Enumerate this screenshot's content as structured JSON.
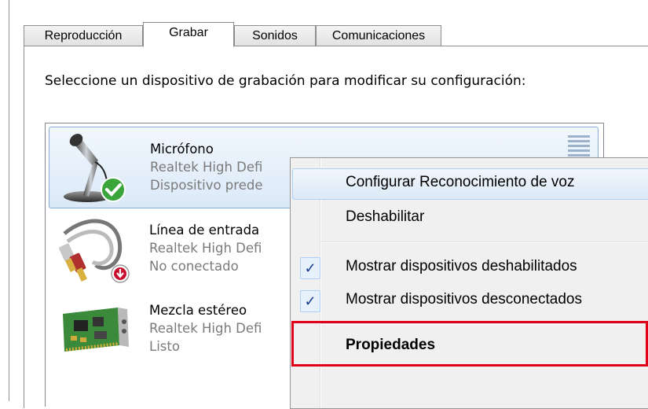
{
  "tabs": [
    {
      "label": "Reproducción"
    },
    {
      "label": "Grabar",
      "active": true
    },
    {
      "label": "Sonidos"
    },
    {
      "label": "Comunicaciones"
    }
  ],
  "instruction": "Seleccione un dispositivo de grabación para modificar su configuración:",
  "devices": [
    {
      "name": "Micrófono",
      "driver": "Realtek High Defi",
      "status": "Dispositivo prede",
      "icon": "microphone-icon",
      "badge": "default-check-icon",
      "selected": true
    },
    {
      "name": "Línea de entrada",
      "driver": "Realtek High Defi",
      "status": "No conectado",
      "icon": "line-in-cable-icon",
      "badge": "disconnected-arrow-icon"
    },
    {
      "name": "Mezcla estéreo",
      "driver": "Realtek High Defi",
      "status": "Listo",
      "icon": "sound-card-icon"
    }
  ],
  "context_menu": {
    "items": [
      {
        "label": "Configurar Reconocimiento de voz",
        "hovered": true
      },
      {
        "label": "Deshabilitar"
      },
      {
        "label": "Mostrar dispositivos deshabilitados",
        "checked": true
      },
      {
        "label": "Mostrar dispositivos desconectados",
        "checked": true
      },
      {
        "label": "Propiedades",
        "bold": true,
        "highlighted": true
      }
    ],
    "check_glyph": "✓"
  },
  "colors": {
    "highlight": "#e0001a",
    "selection_border": "#84acdd",
    "check": "#1a3c8f"
  }
}
